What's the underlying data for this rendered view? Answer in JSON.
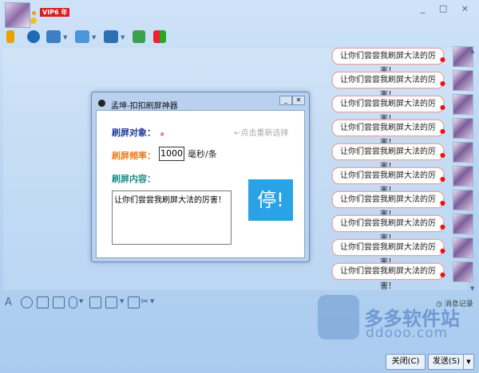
{
  "header": {
    "vip_badge": "VIP6 年",
    "window_controls": "_ □ ×"
  },
  "toolbar": {
    "icons": [
      "microphone-icon",
      "camera-icon",
      "screen-share-icon",
      "folder-icon",
      "remote-desktop-icon",
      "app-icon",
      "grid-icon"
    ]
  },
  "chat": {
    "messages": [
      "让你们尝尝我刷屏大法的厉害！",
      "让你们尝尝我刷屏大法的厉害！",
      "让你们尝尝我刷屏大法的厉害！",
      "让你们尝尝我刷屏大法的厉害！",
      "让你们尝尝我刷屏大法的厉害！",
      "让你们尝尝我刷屏大法的厉害！",
      "让你们尝尝我刷屏大法的厉害！",
      "让你们尝尝我刷屏大法的厉害！",
      "让你们尝尝我刷屏大法的厉害！",
      "让你们尝尝我刷屏大法的厉害！"
    ]
  },
  "dialog": {
    "title": "孟坤-扣扣刷屏神器",
    "target_label": "刷屏对象：",
    "target_value": "。",
    "reselect_hint": "←点击重新选择",
    "freq_label": "刷屏频率：",
    "freq_value": "1000",
    "freq_unit": "毫秒/条",
    "content_label": "刷屏内容：",
    "content_value": "让你们尝尝我刷屏大法的厉害！",
    "stop_button": "停!",
    "colors": {
      "target_label": "#1f3a9a",
      "freq_label": "#ea7c1e",
      "content_label": "#1b8a8a",
      "stop": "#29a3e6"
    }
  },
  "input": {
    "history_label": "消息记录",
    "close_button": "关闭(C)",
    "send_button": "发送(S)"
  },
  "watermark": {
    "name": "多多软件站",
    "url": "ddooo.com"
  }
}
